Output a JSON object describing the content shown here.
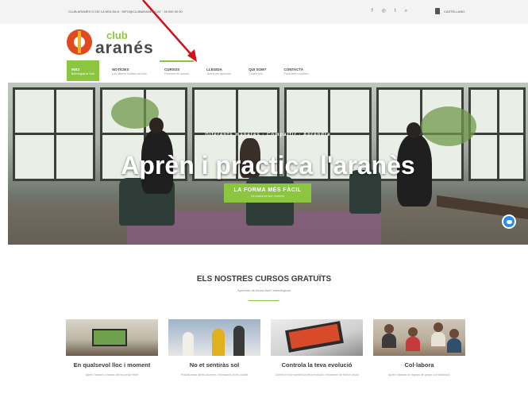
{
  "topbar": {
    "contact": "CLUB ARANÈS  C/ DE LA MOLSA 8  ·  INFO@CLUBARANES.CAT  ·  93 000 00 00",
    "social_icons": [
      "facebook-icon",
      "instagram-icon",
      "twitter-icon",
      "search-icon"
    ],
    "social_glyphs": [
      "f",
      "◎",
      "t",
      "⌕"
    ],
    "language": "CASTELLANO"
  },
  "logo": {
    "club": "club",
    "name": "aranés"
  },
  "nav": {
    "items": [
      {
        "label": "INICI",
        "sub": "Benvinguts al Club"
      },
      {
        "label": "NOTÍCIES",
        "sub": "Les últimes notícies del club"
      },
      {
        "label": "CURSOS",
        "sub": "Formació en aranès"
      },
      {
        "label": "LLEGIDA",
        "sub": "Textos per aprendre"
      },
      {
        "label": "QUI SOM?",
        "sub": "Coneix-nos"
      },
      {
        "label": "CONTACTA",
        "sub": "Parla amb nosaltres"
      }
    ]
  },
  "hero": {
    "subtitle": "Diferents maneres  ·  Compartir  ·  Aprendre",
    "title": "Aprèn i practica l'aranès",
    "cta_label": "LA FORMA MÉS FÀCIL",
    "cta_sub": "De qualsevol lloc i moment"
  },
  "courses": {
    "title": "ELS NOSTRES CURSOS GRATUÏTS",
    "subtitle": "Aprenent de forma fàcil i entretinguda",
    "cards": [
      {
        "title": "En qualsevol lloc i moment",
        "desc": "Aprèn l'aranès a través del teu propi ritme"
      },
      {
        "title": "No et sentiràs sol",
        "desc": "Podràs estar altres alumnes i formadors al teu costat"
      },
      {
        "title": "Controla la teva evolució",
        "desc": "Coneix en tot moment la teva evolució i rendiment de forma visual"
      },
      {
        "title": "Col·labora",
        "desc": "Aprèn l'aranès en equips de grups i col·laboració"
      }
    ]
  },
  "colors": {
    "accent": "#8cc63f",
    "logo_red": "#e04a1f",
    "annotation_arrow": "#d0121b"
  }
}
